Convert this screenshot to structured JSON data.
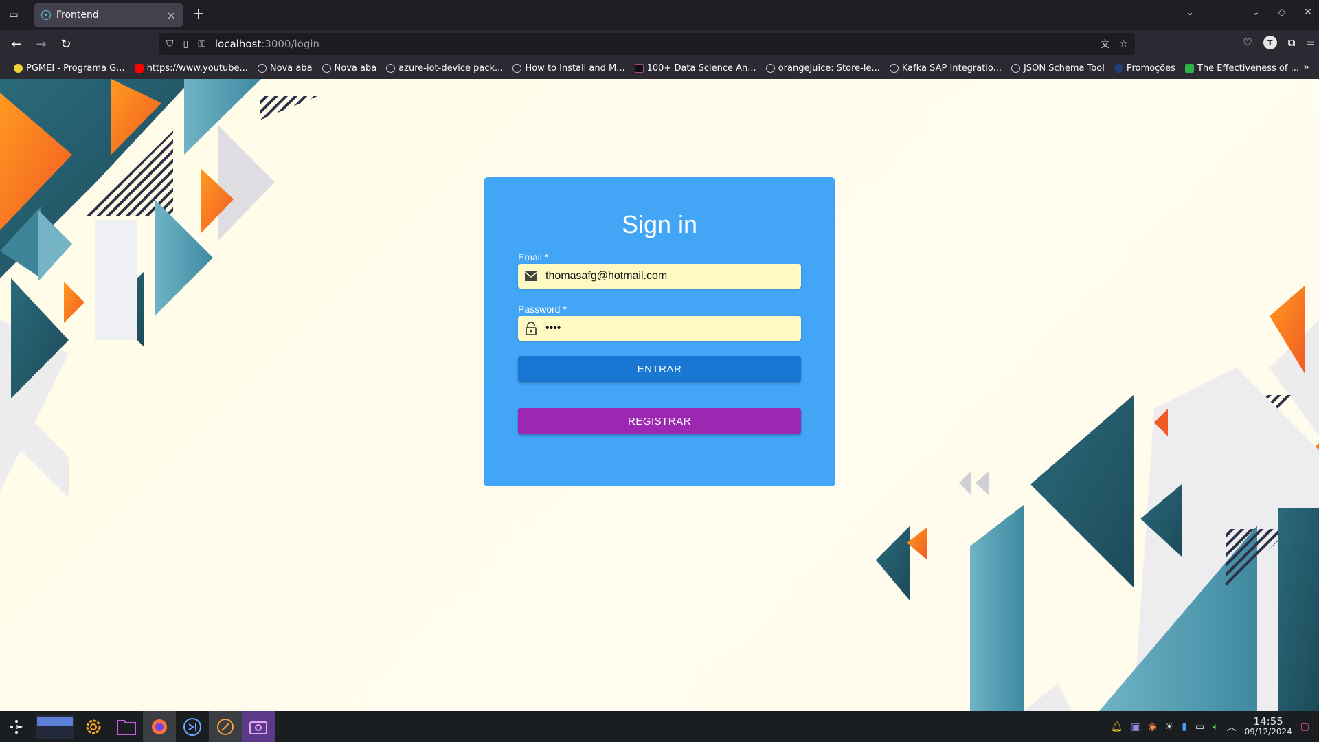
{
  "browser": {
    "tab_title": "Frontend",
    "url_host": "localhost",
    "url_path": ":3000/login",
    "bookmarks": [
      {
        "label": "PGMEI - Programa G...",
        "icon": "pg"
      },
      {
        "label": "https://www.youtube...",
        "icon": "yt"
      },
      {
        "label": "Nova aba",
        "icon": "globe"
      },
      {
        "label": "Nova aba",
        "icon": "globe"
      },
      {
        "label": "azure-iot-device pack...",
        "icon": "globe"
      },
      {
        "label": "How to Install and M...",
        "icon": "globe"
      },
      {
        "label": "100+ Data Science An...",
        "icon": "ds"
      },
      {
        "label": "orangeJuice: Store-le...",
        "icon": "globe"
      },
      {
        "label": "Kafka SAP Integratio...",
        "icon": "globe"
      },
      {
        "label": "JSON Schema Tool",
        "icon": "globe"
      },
      {
        "label": "Promoções",
        "icon": "pr"
      },
      {
        "label": "The Effectiveness of ...",
        "icon": "ef"
      }
    ],
    "profile_initial": "T"
  },
  "login": {
    "title": "Sign in",
    "email_label": "Email *",
    "email_value": "thomasafg@hotmail.com",
    "password_label": "Password *",
    "password_value": "1234",
    "submit_label": "ENTRAR",
    "register_label": "REGISTRAR"
  },
  "taskbar": {
    "time": "14:55",
    "date": "09/12/2024"
  },
  "colors": {
    "card": "#42a5f5",
    "primary_button": "#1976d2",
    "secondary_button": "#9c27b0",
    "input_bg": "#fff9c4"
  }
}
